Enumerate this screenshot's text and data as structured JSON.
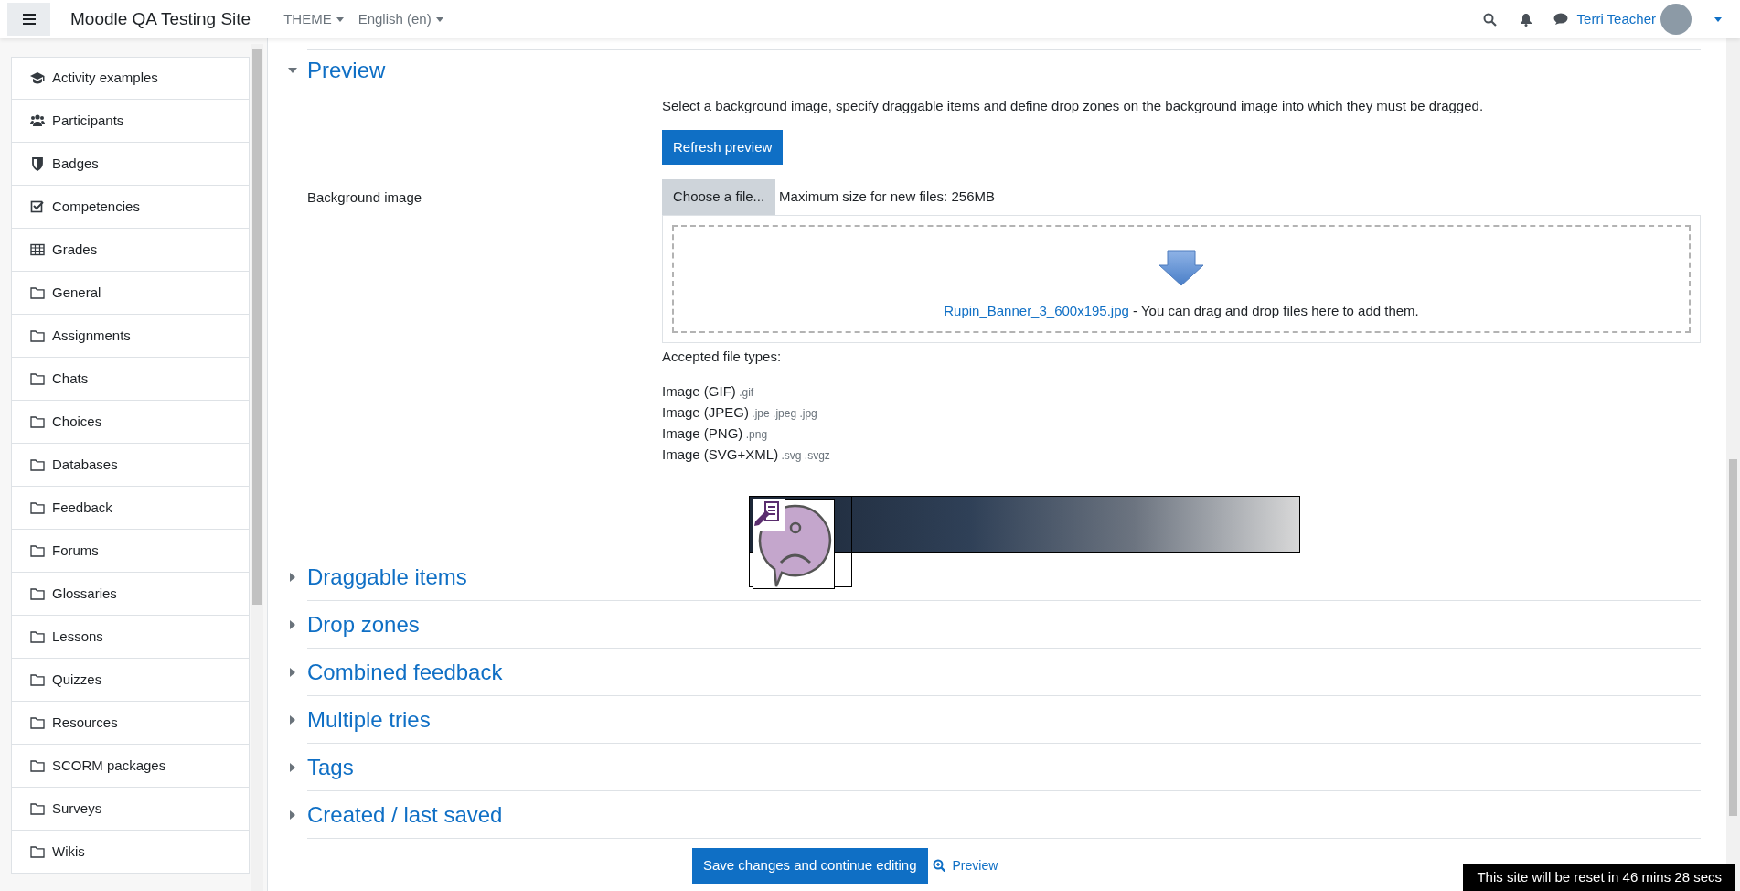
{
  "navbar": {
    "site_name": "Moodle QA Testing Site",
    "menus": [
      "THEME",
      "English (en)"
    ],
    "user_name": "Terri Teacher"
  },
  "sidebar": {
    "items": [
      {
        "label": "Activity examples",
        "kind": "course"
      },
      {
        "label": "Participants",
        "kind": "participants"
      },
      {
        "label": "Badges",
        "kind": "badges"
      },
      {
        "label": "Competencies",
        "kind": "competencies"
      },
      {
        "label": "Grades",
        "kind": "grades"
      },
      {
        "label": "General",
        "kind": "section"
      },
      {
        "label": "Assignments",
        "kind": "section"
      },
      {
        "label": "Chats",
        "kind": "section"
      },
      {
        "label": "Choices",
        "kind": "section"
      },
      {
        "label": "Databases",
        "kind": "section"
      },
      {
        "label": "Feedback",
        "kind": "section"
      },
      {
        "label": "Forums",
        "kind": "section"
      },
      {
        "label": "Glossaries",
        "kind": "section"
      },
      {
        "label": "Lessons",
        "kind": "section"
      },
      {
        "label": "Quizzes",
        "kind": "section"
      },
      {
        "label": "Resources",
        "kind": "section"
      },
      {
        "label": "SCORM packages",
        "kind": "section"
      },
      {
        "label": "Surveys",
        "kind": "section"
      },
      {
        "label": "Wikis",
        "kind": "section"
      }
    ]
  },
  "preview_section": {
    "title": "Preview",
    "expanded": true,
    "description": "Select a background image, specify draggable items and define drop zones on the background image into which they must be dragged.",
    "refresh_button": "Refresh preview",
    "field_label": "Background image",
    "choose_button": "Choose a file...",
    "max_size": "Maximum size for new files: 256MB",
    "file_link": "Rupin_Banner_3_600x195.jpg",
    "drop_text": "- You can drag and drop files here to add them.",
    "accepted_label": "Accepted file types:",
    "file_types": [
      {
        "name": "Image (GIF)",
        "ext": ".gif"
      },
      {
        "name": "Image (JPEG)",
        "ext": ".jpe .jpeg .jpg"
      },
      {
        "name": "Image (PNG)",
        "ext": ".png"
      },
      {
        "name": "Image (SVG+XML)",
        "ext": ".svg .svgz"
      }
    ]
  },
  "sections": [
    {
      "title": "Draggable items",
      "expanded": false
    },
    {
      "title": "Drop zones",
      "expanded": false
    },
    {
      "title": "Combined feedback",
      "expanded": false
    },
    {
      "title": "Multiple tries",
      "expanded": false
    },
    {
      "title": "Tags",
      "expanded": false
    },
    {
      "title": "Created / last saved",
      "expanded": false
    }
  ],
  "footer": {
    "save_button": "Save changes and continue editing",
    "preview_link": "Preview"
  },
  "reset_notice": "This site will be reset in 46 mins 28 secs"
}
